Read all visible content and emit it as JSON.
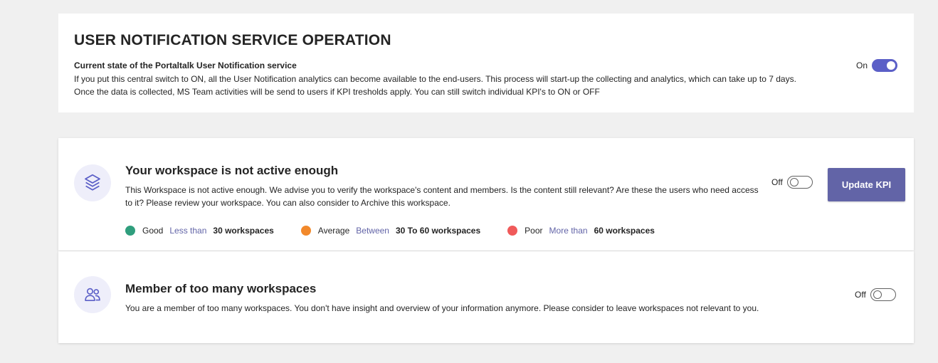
{
  "service": {
    "title": "USER NOTIFICATION SERVICE OPERATION",
    "subtitle": "Current state of the Portaltalk User Notification service",
    "desc_line1": "If you put this central switch to ON, all the User Notification analytics can become available to the end-users. This process will start-up the collecting and analytics, which can take up to 7 days.",
    "desc_line2": "Once the data is collected, MS Team activities will be send to users if KPI tresholds apply. You can still switch individual KPI's to ON or OFF",
    "toggle_label": "On",
    "toggle_state": "on"
  },
  "kpis": [
    {
      "icon": "layers-icon",
      "title": "Your workspace is not active enough",
      "desc": "This Workspace is not active enough. We advise you to verify the workspace's content and members. Is the content still relevant? Are these the users who need access to it? Please review your workspace. You can also consider to Archive this workspace.",
      "toggle_label": "Off",
      "toggle_state": "off",
      "button_label": "Update KPI",
      "thresholds": [
        {
          "label": "Good",
          "relation": "Less than",
          "value": "30 workspaces",
          "color": "#2f9e7d"
        },
        {
          "label": "Average",
          "relation": "Between",
          "value": "30 To 60 workspaces",
          "color": "#f2892b"
        },
        {
          "label": "Poor",
          "relation": "More than",
          "value": "60 workspaces",
          "color": "#f05a5a"
        }
      ]
    },
    {
      "icon": "people-icon",
      "title": "Member of too many workspaces",
      "desc": "You are a member of too many workspaces. You don't have insight and overview of your information anymore. Please consider to leave workspaces not relevant to you.",
      "toggle_label": "Off",
      "toggle_state": "off"
    }
  ],
  "colors": {
    "accent": "#5b5fc7",
    "button": "#6264a7",
    "icon_bg": "#eeeefa"
  }
}
